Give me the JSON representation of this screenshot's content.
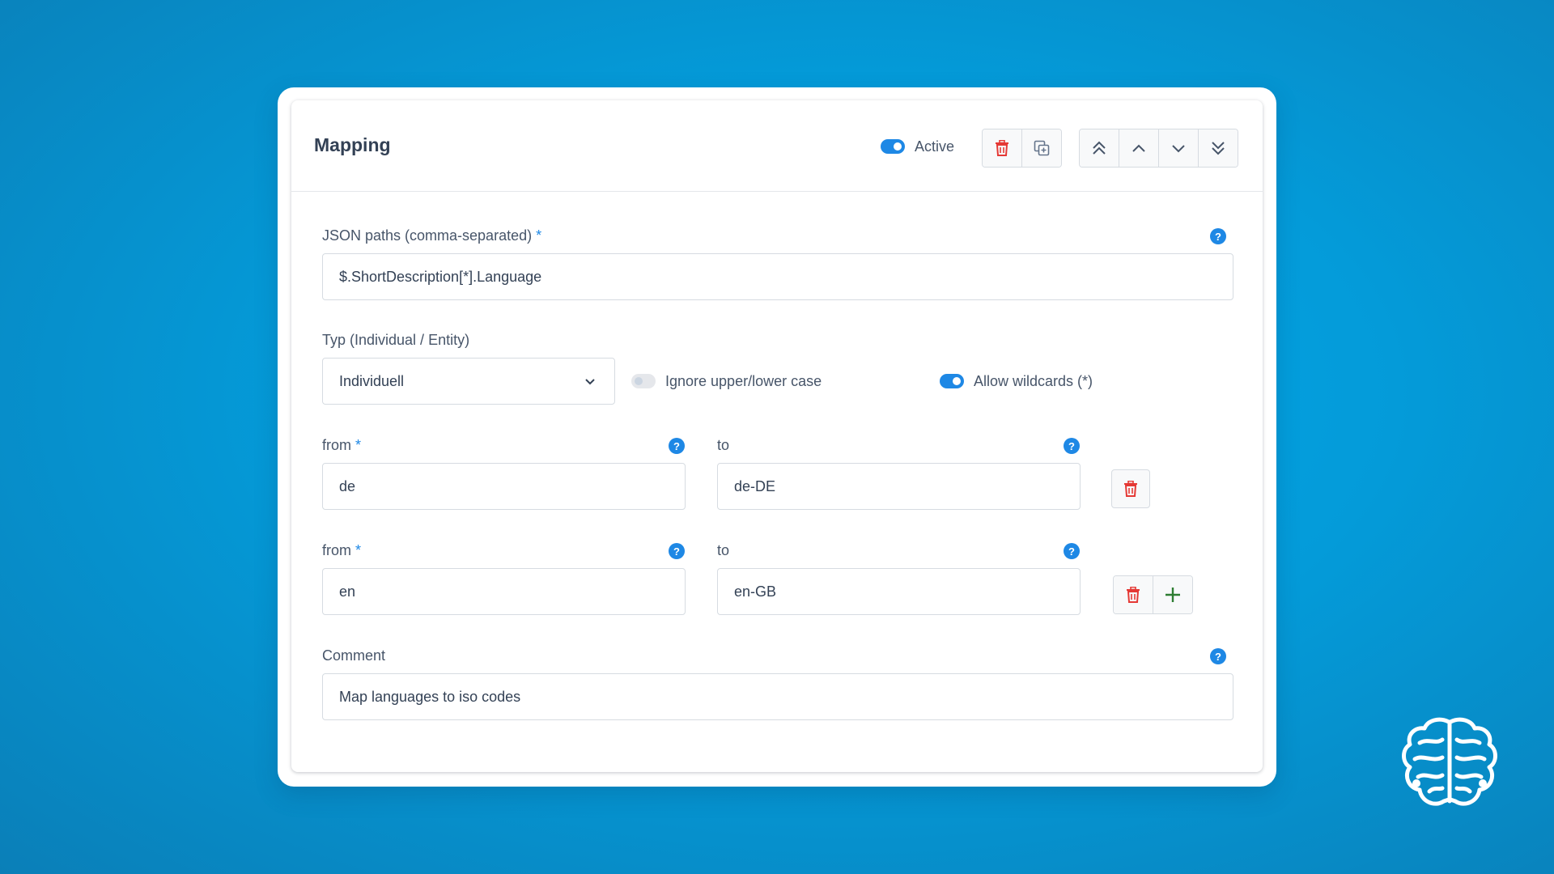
{
  "header": {
    "title": "Mapping",
    "active_label": "Active",
    "active_on": true
  },
  "json_paths": {
    "label": "JSON paths (comma-separated)",
    "required_mark": "*",
    "value": "$.ShortDescription[*].Language"
  },
  "type": {
    "label": "Typ (Individual / Entity)",
    "selected": "Individuell",
    "ignore_case_label": "Ignore upper/lower case",
    "ignore_case_on": false,
    "wildcards_label": "Allow wildcards (*)",
    "wildcards_on": true
  },
  "mappings": [
    {
      "from_label": "from",
      "from_required": "*",
      "from_value": "de",
      "to_label": "to",
      "to_value": "de-DE"
    },
    {
      "from_label": "from",
      "from_required": "*",
      "from_value": "en",
      "to_label": "to",
      "to_value": "en-GB"
    }
  ],
  "comment": {
    "label": "Comment",
    "value": "Map languages to iso codes"
  },
  "help_glyph": "?",
  "colors": {
    "accent": "#1e88e5",
    "delete": "#e53935",
    "add": "#2e7d32",
    "background": "#049bd9"
  },
  "icons": [
    "trash-icon",
    "copy-icon",
    "move-top-icon",
    "move-up-icon",
    "move-down-icon",
    "move-bottom-icon",
    "chevron-down-icon",
    "help-icon",
    "plus-icon",
    "brain-logo-icon"
  ]
}
